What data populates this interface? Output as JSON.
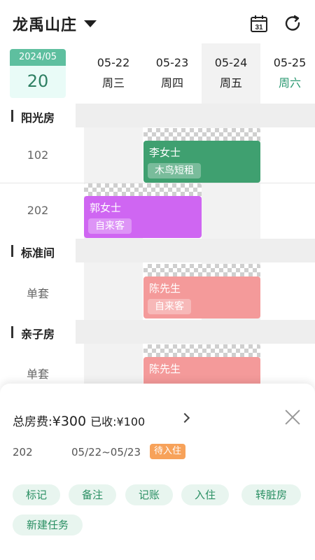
{
  "header": {
    "title": "龙禹山庄",
    "icons": [
      "chevron-down-icon",
      "calendar-icon",
      "refresh-icon"
    ],
    "calendar_day": "31"
  },
  "today": {
    "month": "2024/05",
    "day": "20"
  },
  "dates": [
    {
      "date": "05-22",
      "weekday": "周三"
    },
    {
      "date": "05-23",
      "weekday": "周四"
    },
    {
      "date": "05-24",
      "weekday": "周五"
    },
    {
      "date": "05-25",
      "weekday": "周六"
    }
  ],
  "sections": [
    {
      "label": "阳光房",
      "rooms": [
        "102",
        "202"
      ]
    },
    {
      "label": "标准间",
      "rooms": [
        "单套"
      ]
    },
    {
      "label": "亲子房",
      "rooms": [
        "单套"
      ]
    }
  ],
  "bookings": [
    {
      "name": "李女士",
      "tag": "木鸟短租",
      "color": "#3fa070"
    },
    {
      "name": "郭女士",
      "tag": "自来客",
      "color": "#cf66f2"
    },
    {
      "name": "陈先生",
      "tag": "自来客",
      "color": "#f49a9a"
    },
    {
      "name": "陈先生",
      "tag": "",
      "color": "#f49a9a"
    }
  ],
  "sheet": {
    "fee_label": "总房费:",
    "fee_amount": "¥300",
    "received": "已收:¥100",
    "room": "202",
    "date_range": "05/22~05/23",
    "status": "待入住",
    "actions": [
      "标记",
      "备注",
      "记账",
      "入住",
      "转脏房",
      "新建任务"
    ]
  },
  "colors": {
    "accent": "#5ebf9f",
    "status": "#f7a25a",
    "action_bg": "#e8f5ef",
    "action_text": "#2a8f63"
  }
}
